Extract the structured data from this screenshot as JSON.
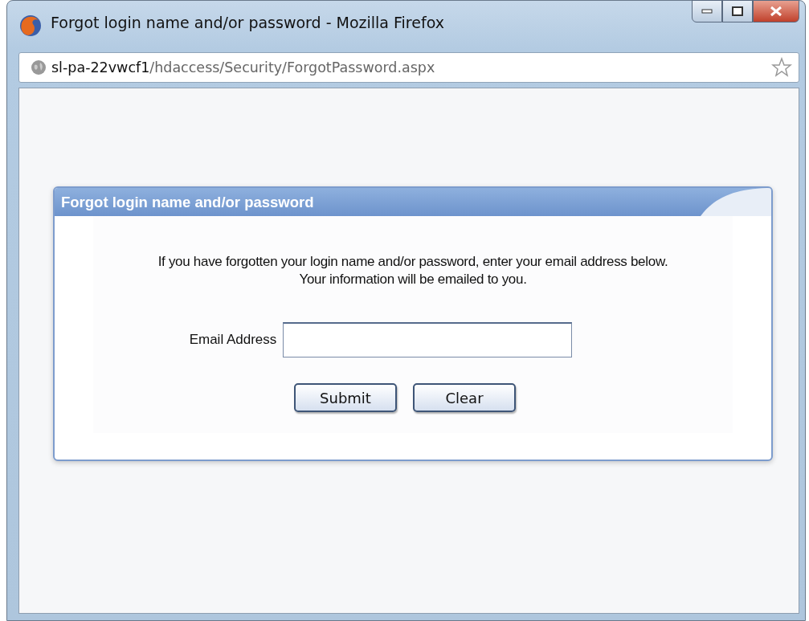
{
  "window": {
    "title": "Forgot login name and/or password - Mozilla Firefox"
  },
  "address_bar": {
    "host": "sl-pa-22vwcf1",
    "path": "/hdaccess/Security/ForgotPassword.aspx"
  },
  "panel": {
    "title": "Forgot login name and/or password",
    "instructions": [
      "If you have forgotten your login name and/or password, enter your email address below.",
      "Your information will be emailed to you."
    ],
    "email_label": "Email Address",
    "buttons": [
      "Submit",
      "Clear"
    ]
  }
}
